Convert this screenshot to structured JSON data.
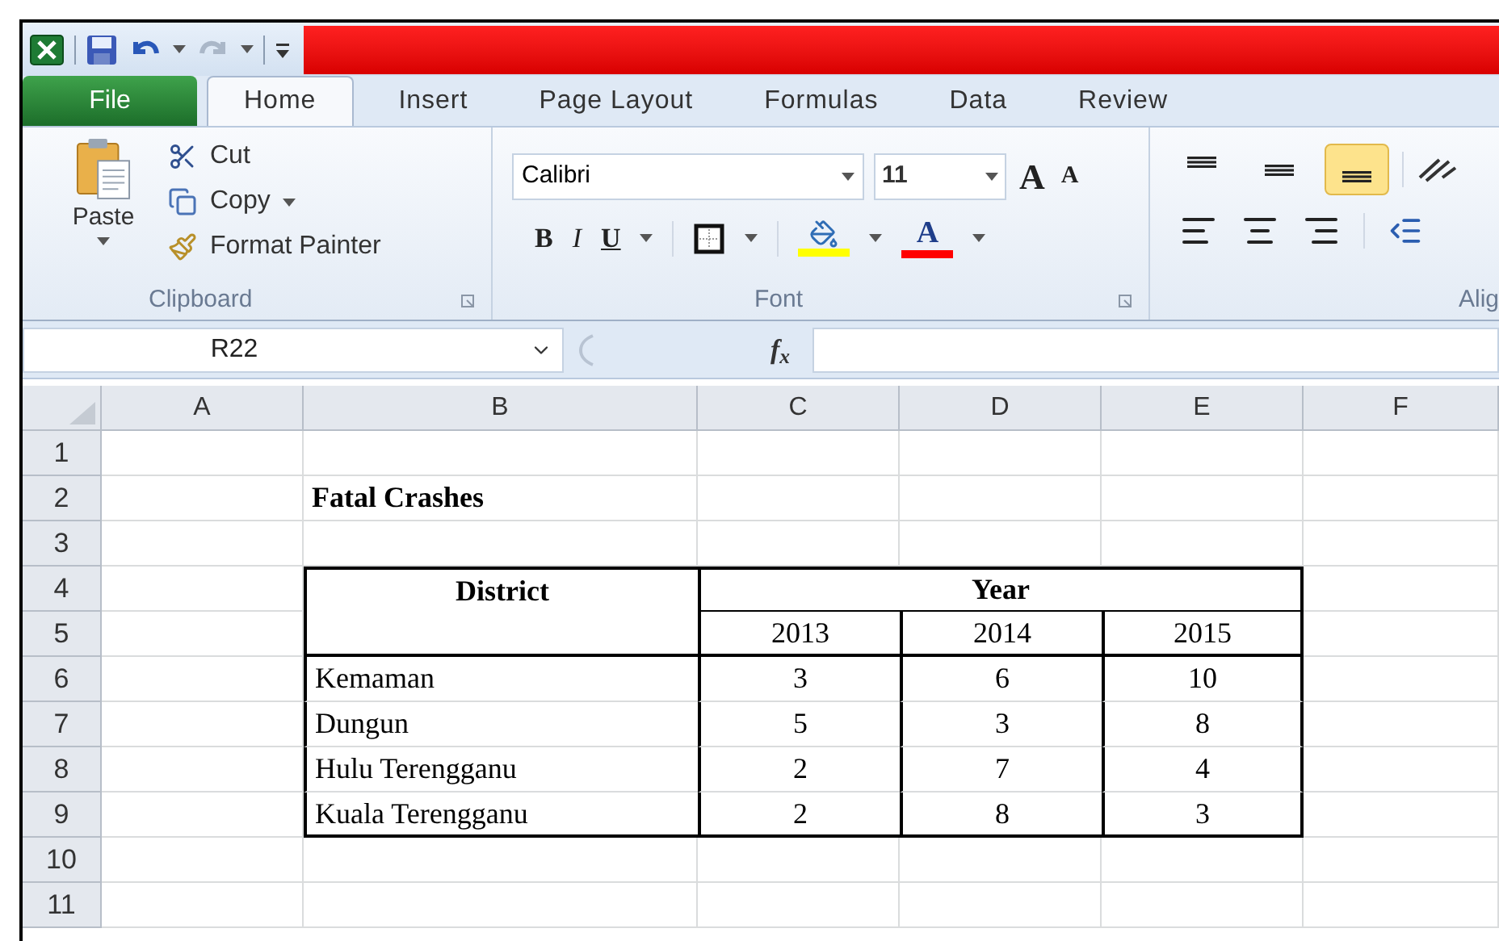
{
  "tabs": [
    {
      "label": "File",
      "kind": "file",
      "selected": false
    },
    {
      "label": "Home",
      "kind": "tab",
      "selected": true
    },
    {
      "label": "Insert",
      "kind": "tab",
      "selected": false
    },
    {
      "label": "Page Layout",
      "kind": "tab",
      "selected": false
    },
    {
      "label": "Formulas",
      "kind": "tab",
      "selected": false
    },
    {
      "label": "Data",
      "kind": "tab",
      "selected": false
    },
    {
      "label": "Review",
      "kind": "tab",
      "selected": false
    }
  ],
  "clipboard": {
    "label": "Clipboard",
    "paste": "Paste",
    "cut": "Cut",
    "copy": "Copy",
    "format_painter": "Format Painter"
  },
  "font": {
    "label": "Font",
    "font_name": "Calibri",
    "font_size": "11",
    "grow": "A",
    "shrink": "A",
    "bold": "B",
    "italic": "I",
    "underline": "U",
    "font_color": "A"
  },
  "alignment": {
    "label": "Alig",
    "vertical_align": [
      {
        "selected": false
      },
      {
        "selected": false
      },
      {
        "selected": true
      }
    ]
  },
  "name_box": "R22",
  "fx": "f$_{x}$",
  "columns": [
    "A",
    "B",
    "C",
    "D",
    "E",
    "F"
  ],
  "rows": [
    {
      "number": "1",
      "kind": "empty",
      "cells": []
    },
    {
      "number": "2",
      "kind": "title",
      "cells": [
        "Fatal Crashes"
      ]
    },
    {
      "number": "3",
      "kind": "empty",
      "cells": []
    },
    {
      "number": "4",
      "kind": "header_top",
      "cells": [
        "District",
        "Year"
      ]
    },
    {
      "number": "5",
      "kind": "header_bottom",
      "cells": [
        "2013",
        "2014",
        "2015"
      ]
    },
    {
      "number": "6",
      "kind": "data",
      "cells": [
        "Kemaman",
        "3",
        "6",
        "10"
      ]
    },
    {
      "number": "7",
      "kind": "data",
      "cells": [
        "Dungun",
        "5",
        "3",
        "8"
      ]
    },
    {
      "number": "8",
      "kind": "data",
      "cells": [
        "Hulu Terengganu",
        "2",
        "7",
        "4"
      ]
    },
    {
      "number": "9",
      "kind": "data",
      "cells": [
        "Kuala Terengganu",
        "2",
        "8",
        "3"
      ]
    },
    {
      "number": "10",
      "kind": "empty",
      "cells": []
    },
    {
      "number": "11",
      "kind": "empty",
      "cells": []
    }
  ]
}
